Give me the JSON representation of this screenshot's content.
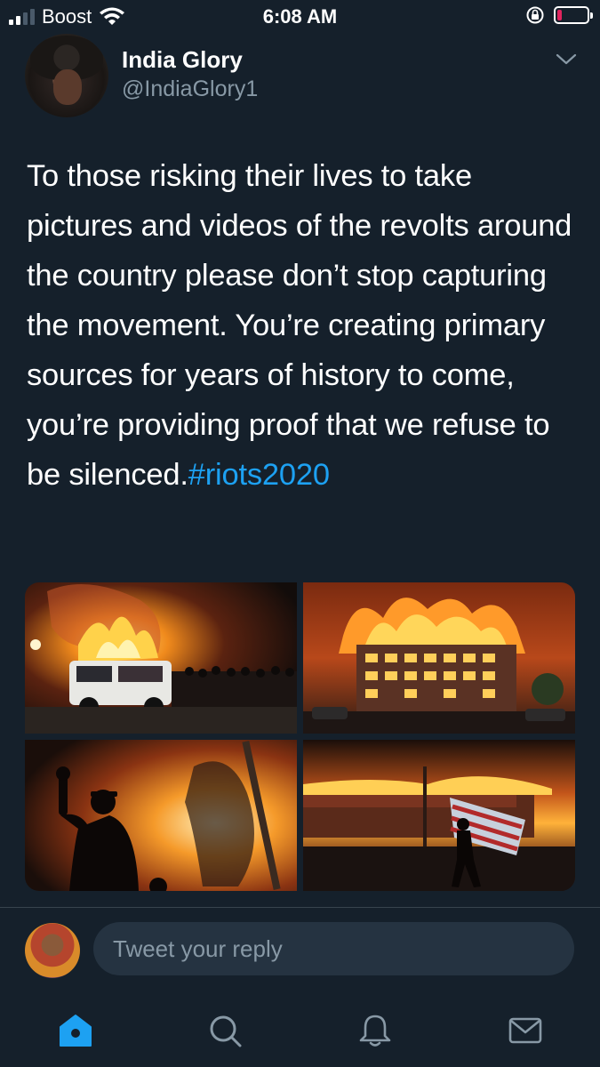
{
  "status_bar": {
    "carrier": "Boost",
    "time": "6:08 AM",
    "signal_bars_filled": 2,
    "signal_bars_total": 4,
    "battery_level": "low",
    "battery_color": "#e0245e"
  },
  "tweet": {
    "author_name": "India Glory",
    "author_handle": "@IndiaGlory1",
    "text": "To those risking their lives to take pictures and videos of the revolts around the country please don’t stop capturing the movement. You’re creating primary sources for years of history to come, you’re providing proof that we refuse to be silenced.",
    "hashtag": "#riots2020",
    "hashtag_color": "#1da1f2",
    "media": [
      {
        "icon": "photo-burning-police-car"
      },
      {
        "icon": "photo-burning-building"
      },
      {
        "icon": "photo-protester-raised-fist"
      },
      {
        "icon": "photo-protester-with-flag"
      }
    ]
  },
  "reply": {
    "placeholder": "Tweet your reply"
  },
  "bottom_nav": {
    "items": [
      {
        "icon": "home-icon",
        "active": true
      },
      {
        "icon": "search-icon",
        "active": false
      },
      {
        "icon": "bell-icon",
        "active": false
      },
      {
        "icon": "mail-icon",
        "active": false
      }
    ],
    "active_color": "#1da1f2",
    "inactive_color": "#8899a6"
  },
  "theme": {
    "background": "#15202b",
    "secondary_text": "#8899a6",
    "divider": "#38444d",
    "input_background": "#253341"
  }
}
